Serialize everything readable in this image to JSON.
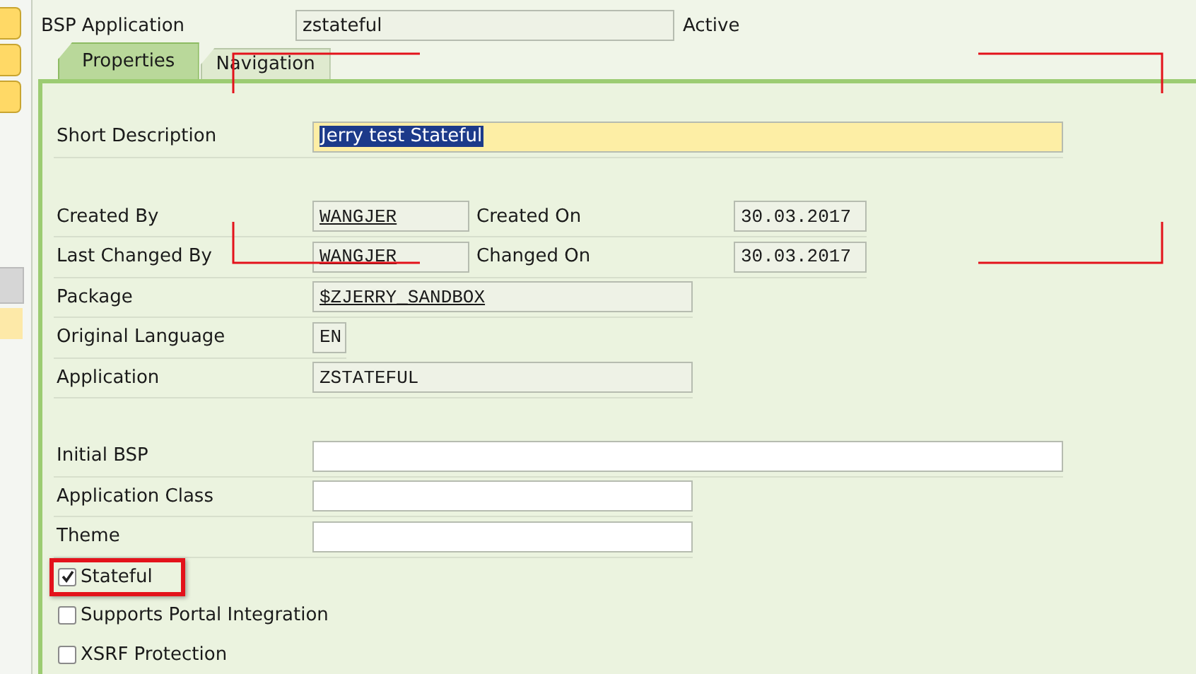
{
  "header": {
    "label": "BSP Application",
    "value": "zstateful",
    "status": "Active"
  },
  "tabs": [
    {
      "label": "Properties",
      "selected": true
    },
    {
      "label": "Navigation",
      "selected": false
    }
  ],
  "short_description": {
    "label": "Short Description",
    "value": "Jerry test Stateful",
    "selected_text": true
  },
  "info_fields": [
    {
      "kind": "pair",
      "label": "Created By",
      "value": "WANGJER",
      "linked": true,
      "side_label": "Created On",
      "side_value": "30.03.2017"
    },
    {
      "kind": "pair",
      "label": "Last Changed By",
      "value": "WANGJER",
      "linked": true,
      "side_label": "Changed On",
      "side_value": "30.03.2017"
    },
    {
      "kind": "wide",
      "label": "Package",
      "value": "$ZJERRY_SANDBOX",
      "linked": true
    },
    {
      "kind": "narrow",
      "label": "Original Language",
      "value": "EN",
      "linked": false
    },
    {
      "kind": "wide",
      "label": "Application",
      "value": "ZSTATEFUL",
      "linked": false
    }
  ],
  "input_fields": [
    {
      "kind": "long",
      "label": "Initial BSP"
    },
    {
      "kind": "medium",
      "label": "Application Class"
    },
    {
      "kind": "medium",
      "label": "Theme"
    }
  ],
  "checkboxes": [
    {
      "label": "Stateful",
      "checked": true,
      "highlighted": true
    },
    {
      "label": "Supports Portal Integration",
      "checked": false,
      "highlighted": false
    },
    {
      "label": "XSRF Protection",
      "checked": false,
      "highlighted": false
    }
  ]
}
